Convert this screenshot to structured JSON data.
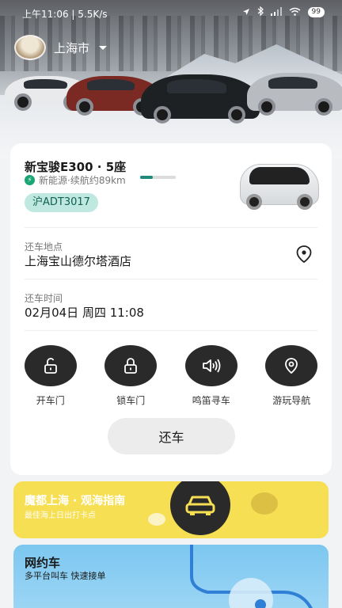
{
  "status_bar": {
    "time": "上午11:06 | 5.5K/s",
    "battery": "99"
  },
  "header": {
    "city": "上海市"
  },
  "vehicle": {
    "name": "新宝骏E300 · 5座",
    "energy": "新能源·续航约89km",
    "range_fraction": 0.35,
    "plate": "沪ADT3017"
  },
  "return_location": {
    "label": "还车地点",
    "value": "上海宝山德尔塔酒店"
  },
  "return_time": {
    "label": "还车时间",
    "value": "02月04日 周四 11:08"
  },
  "actions": [
    {
      "label": "开车门",
      "icon": "unlock-icon"
    },
    {
      "label": "锁车门",
      "icon": "lock-icon"
    },
    {
      "label": "鸣笛寻车",
      "icon": "speaker-icon"
    },
    {
      "label": "游玩导航",
      "icon": "location-icon"
    }
  ],
  "return_button": "还车",
  "promo": {
    "title": "魔都上海 · 观海指南",
    "subtitle": "最佳海上日出打卡点"
  },
  "ride": {
    "title": "网约车",
    "subtitle": "多平台叫车 快速接单"
  },
  "colors": {
    "accent_green": "#1f8a7b",
    "plate_bg": "#bfe9e0",
    "promo_yellow": "#f7df54",
    "ride_blue": "#7cc7f0"
  }
}
